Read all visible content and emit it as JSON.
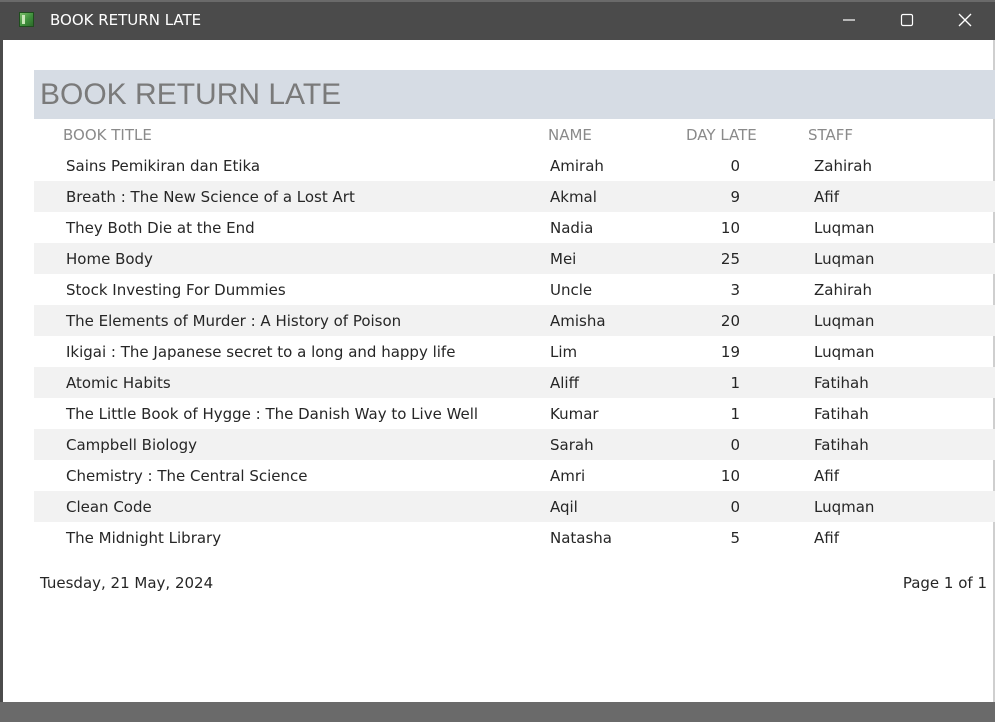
{
  "window": {
    "title": "BOOK RETURN LATE",
    "app_icon": "report-book-icon"
  },
  "report": {
    "title": "BOOK RETURN LATE",
    "columns": {
      "book_title": "BOOK TITLE",
      "name": "NAME",
      "day_late": "DAY LATE",
      "staff": "STAFF"
    },
    "rows": [
      {
        "book_title": "Sains Pemikiran dan Etika",
        "name": "Amirah",
        "day_late": "0",
        "staff": "Zahirah"
      },
      {
        "book_title": "Breath : The New Science of a Lost Art",
        "name": "Akmal",
        "day_late": "9",
        "staff": "Afif"
      },
      {
        "book_title": "They Both Die at the End",
        "name": "Nadia",
        "day_late": "10",
        "staff": "Luqman"
      },
      {
        "book_title": "Home Body",
        "name": "Mei",
        "day_late": "25",
        "staff": "Luqman"
      },
      {
        "book_title": "Stock Investing For Dummies",
        "name": "Uncle",
        "day_late": "3",
        "staff": "Zahirah"
      },
      {
        "book_title": "The Elements of Murder : A History of Poison",
        "name": "Amisha",
        "day_late": "20",
        "staff": "Luqman"
      },
      {
        "book_title": "Ikigai : The Japanese secret to a long and happy life",
        "name": "Lim",
        "day_late": "19",
        "staff": "Luqman"
      },
      {
        "book_title": "Atomic Habits",
        "name": "Aliff",
        "day_late": "1",
        "staff": "Fatihah"
      },
      {
        "book_title": "The Little Book of Hygge : The Danish Way to Live Well",
        "name": "Kumar",
        "day_late": "1",
        "staff": "Fatihah"
      },
      {
        "book_title": "Campbell Biology",
        "name": "Sarah",
        "day_late": "0",
        "staff": "Fatihah"
      },
      {
        "book_title": "Chemistry : The Central Science",
        "name": "Amri",
        "day_late": "10",
        "staff": "Afif"
      },
      {
        "book_title": "Clean Code",
        "name": "Aqil",
        "day_late": "0",
        "staff": "Luqman"
      },
      {
        "book_title": "The Midnight Library",
        "name": "Natasha",
        "day_late": "5",
        "staff": "Afif"
      }
    ],
    "footer": {
      "date": "Tuesday, 21 May, 2024",
      "page": "Page 1 of 1"
    }
  },
  "colors": {
    "titlebar": "#4b4b4b",
    "header_band": "#d6dce4",
    "alt_row": "#f2f2f2",
    "title_text": "#7a7a7a"
  }
}
